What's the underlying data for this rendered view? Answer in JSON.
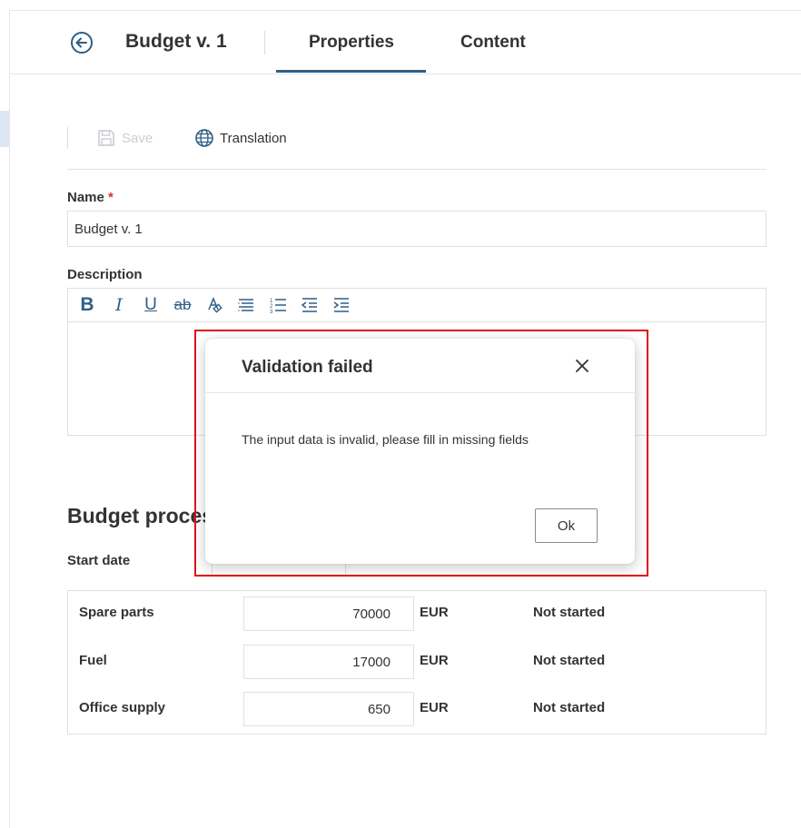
{
  "header": {
    "title": "Budget v. 1",
    "tabs": [
      {
        "label": "Properties",
        "active": true
      },
      {
        "label": "Content",
        "active": false
      }
    ]
  },
  "toolbar": {
    "save_label": "Save",
    "translation_label": "Translation"
  },
  "form": {
    "name_label": "Name",
    "name_required_mark": "*",
    "name_value": "Budget v. 1",
    "description_label": "Description",
    "editor_tools": [
      "bold-icon",
      "italic-icon",
      "underline-icon",
      "strikethrough-icon",
      "clear-format-icon",
      "align-icon",
      "ordered-list-icon",
      "outdent-icon",
      "indent-icon"
    ]
  },
  "budget_section": {
    "title": "Budget process",
    "start_date_label": "Start date",
    "rows": [
      {
        "label": "Spare parts",
        "amount": "70000",
        "currency": "EUR",
        "status": "Not started"
      },
      {
        "label": "Fuel",
        "amount": "17000",
        "currency": "EUR",
        "status": "Not started"
      },
      {
        "label": "Office supply",
        "amount": "650",
        "currency": "EUR",
        "status": "Not started"
      }
    ]
  },
  "dialog": {
    "title": "Validation failed",
    "message": "The input data is invalid, please fill in missing fields",
    "ok_label": "Ok"
  },
  "colors": {
    "accent": "#2d5f87",
    "highlight": "#e0101a",
    "required": "#d13438"
  }
}
